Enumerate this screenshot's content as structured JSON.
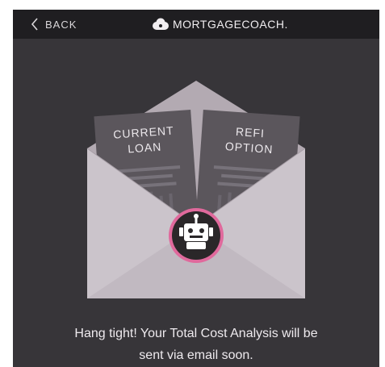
{
  "nav": {
    "back_label": "BACK",
    "back_icon": "chevron-left-icon"
  },
  "brand": {
    "name": "MORTGAGECOACH.",
    "logo_icon": "cloud-logo-icon"
  },
  "illustration": {
    "doc_left": {
      "line1": "CURRENT",
      "line2": "LOAN"
    },
    "doc_right": {
      "line1": "REFI",
      "line2": "OPTION"
    },
    "badge_icon": "robot-icon",
    "colors": {
      "envelope_back": "#b3aab2",
      "envelope_front": "#cbc4cb",
      "document": "#5b565c",
      "badge_ring": "#e0699c",
      "badge_fill": "#2a2729"
    }
  },
  "message": {
    "line1": "Hang tight! Your Total Cost Analysis will be",
    "line2": "sent via email soon."
  }
}
